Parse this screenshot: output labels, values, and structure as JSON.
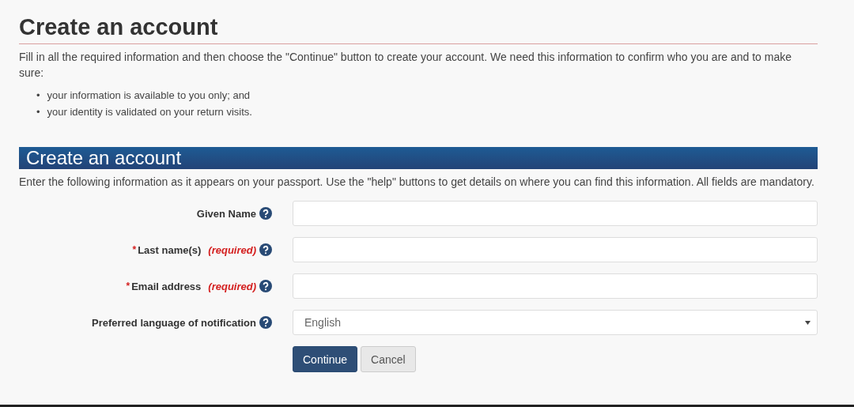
{
  "page_title": "Create an account",
  "intro": "Fill in all the required information and then choose the \"Continue\" button to create your account. We need this information to confirm who you are and to make sure:",
  "bullets": [
    {
      "marker": "•",
      "text": "your information is available to you only; and"
    },
    {
      "marker": "•",
      "text": "your identity is validated on your return visits."
    }
  ],
  "section": {
    "title": "Create an account",
    "description": "Enter the following information as it appears on your passport. Use the \"help\" buttons to get details on where you can find this information. All fields are mandatory."
  },
  "fields": [
    {
      "kind": "text",
      "label": "Given Name",
      "required": false
    },
    {
      "kind": "text",
      "label": "Last name(s)",
      "required": true,
      "required_mark": "*",
      "required_note": "(required)"
    },
    {
      "kind": "text",
      "label": "Email address",
      "required": true,
      "required_mark": "*",
      "required_note": "(required)"
    },
    {
      "kind": "select",
      "label": "Preferred language of notification",
      "required": false,
      "value": "English"
    }
  ],
  "buttons": [
    {
      "label": "Continue",
      "kind": "primary"
    },
    {
      "label": "Cancel",
      "kind": "secondary"
    }
  ]
}
